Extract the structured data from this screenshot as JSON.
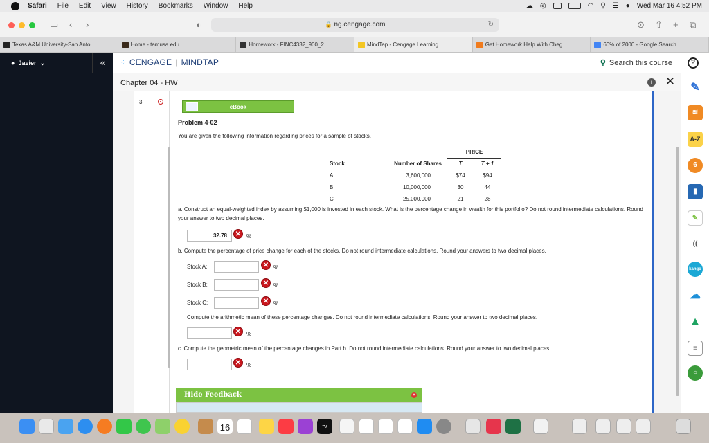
{
  "menubar": {
    "app": "Safari",
    "menus": [
      "File",
      "Edit",
      "View",
      "History",
      "Bookmarks",
      "Window",
      "Help"
    ],
    "clock": "Wed Mar 16  4:52 PM"
  },
  "browser": {
    "url": "ng.cengage.com",
    "tabs": [
      {
        "label": "Texas A&M University-San Anto...",
        "color": "#222"
      },
      {
        "label": "Home - tamusa.edu",
        "color": "#3a2a1a"
      },
      {
        "label": "Homework - FINC4332_900_2...",
        "color": "#333"
      },
      {
        "label": "MindTap - Cengage Learning",
        "color": "#f3c623"
      },
      {
        "label": "Get Homework Help With Cheg...",
        "color": "#f07b1d"
      },
      {
        "label": "60% of 2000 - Google Search",
        "color": "#4285f4"
      }
    ]
  },
  "sidebar": {
    "user": "Javier",
    "collapse": "«"
  },
  "nav": {
    "logo_left": "CENGAGE",
    "logo_right": "MINDTAP",
    "search": "Search this course",
    "help": "?"
  },
  "chapter": {
    "title": "Chapter 04 - HW",
    "info": "i",
    "close": "✕"
  },
  "question": {
    "number": "3.",
    "ebook": "eBook",
    "title": "Problem 4-02",
    "intro": "You are given the following information regarding prices for a sample of stocks.",
    "table": {
      "price_header": "PRICE",
      "headers": [
        "Stock",
        "Number of Shares",
        "T",
        "T + 1"
      ],
      "rows": [
        [
          "A",
          "3,600,000",
          "$74",
          "$94"
        ],
        [
          "B",
          "10,000,000",
          "30",
          "44"
        ],
        [
          "C",
          "25,000,000",
          "21",
          "28"
        ]
      ]
    },
    "part_a": "a.  Construct an equal-weighted index by assuming $1,000 is invested in each stock. What is the percentage change in wealth for this portfolio? Do not round intermediate calculations. Round your answer to two decimal places.",
    "part_a_value": "32.78",
    "pct": "%",
    "part_b": "b.  Compute the percentage of price change for each of the stocks. Do not round intermediate calculations. Round your answers to two decimal places.",
    "stock_a": "Stock A:",
    "stock_b": "Stock B:",
    "stock_c": "Stock C:",
    "arith": "Compute the arithmetic mean of these percentage changes. Do not round intermediate calculations. Round your answer to two decimal places.",
    "part_c": "c.  Compute the geometric mean of the percentage changes in Part b. Do not round intermediate calculations. Round your answer to two decimal places.",
    "feedback": "Hide Feedback",
    "wrong_mark": "✕"
  },
  "dock": {
    "calendar_day": "16",
    "tv": "tv"
  }
}
